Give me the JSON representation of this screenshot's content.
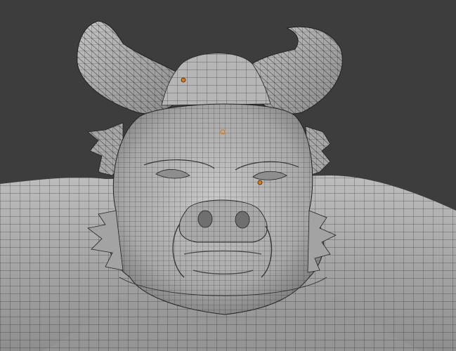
{
  "viewport": {
    "background_color": "#3d3d3d",
    "mesh_fill_color": "#b9b9b9",
    "mesh_wire_color": "#1a1a1a",
    "vertex_dot_color": "#e07a10"
  },
  "icons": {
    "mesh": "sculpt-mesh-icon",
    "vertex": "selected-vertex-icon"
  }
}
